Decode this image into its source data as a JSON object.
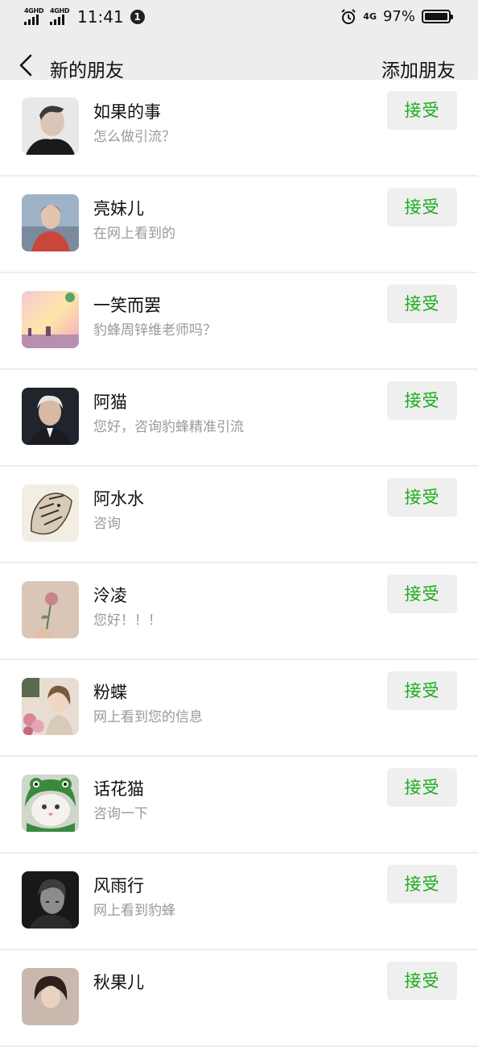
{
  "status_bar": {
    "network_1": "4GHD",
    "network_2": "4GHD",
    "time": "11:41",
    "notification_count": "1",
    "network_right": "4G",
    "battery": "97%",
    "battery_level": 0.97
  },
  "nav": {
    "title": "新的朋友",
    "action": "添加朋友"
  },
  "accept_color": "#1aad19",
  "friends": [
    {
      "name": "如果的事",
      "message": "怎么做引流？",
      "action": "接受",
      "avatar": "man-portrait"
    },
    {
      "name": "亮妹儿",
      "message": "在网上看到的",
      "action": "接受",
      "avatar": "young-man-photo"
    },
    {
      "name": "一笑而罢",
      "message": "豹蜂周锌维老师吗？",
      "action": "接受",
      "avatar": "pink-sky-scene"
    },
    {
      "name": "阿猫",
      "message": "您好，咨询豹蜂精准引流",
      "action": "接受",
      "avatar": "old-man-portrait"
    },
    {
      "name": "阿水水",
      "message": "咨询",
      "action": "接受",
      "avatar": "tiger-drawing"
    },
    {
      "name": "泠凌",
      "message": "您好！！！",
      "action": "接受",
      "avatar": "rose-in-hand"
    },
    {
      "name": "粉蝶",
      "message": "网上看到您的信息",
      "action": "接受",
      "avatar": "girl-with-flowers"
    },
    {
      "name": "话花猫",
      "message": "咨询一下",
      "action": "接受",
      "avatar": "cat-frog-hat"
    },
    {
      "name": "风雨行",
      "message": "网上看到豹蜂",
      "action": "接受",
      "avatar": "bw-man-portrait"
    },
    {
      "name": "秋果儿",
      "message": "",
      "action": "接受",
      "avatar": "woman-portrait"
    }
  ]
}
